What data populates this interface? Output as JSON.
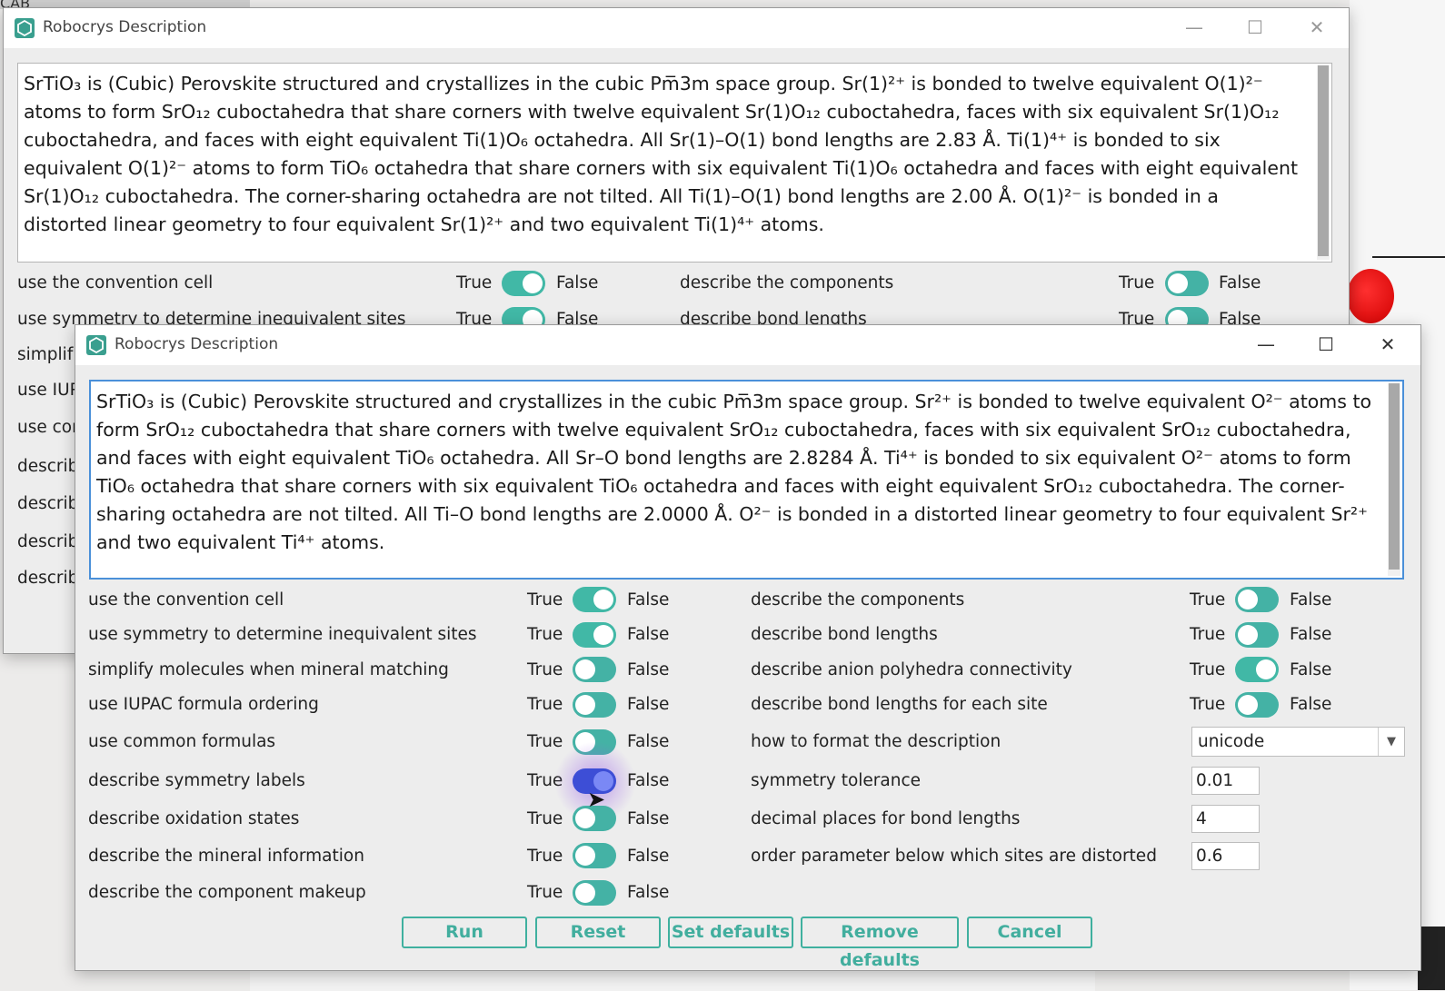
{
  "background": {
    "corner_label": "CAB"
  },
  "win1": {
    "title": "Robocrys Description",
    "description": "SrTiO₃ is (Cubic) Perovskite structured and crystallizes in the cubic Pm̅3m space group. Sr(1)²⁺ is bonded to twelve equivalent O(1)²⁻ atoms to form SrO₁₂ cuboctahedra that share corners with twelve equivalent Sr(1)O₁₂ cuboctahedra, faces with six equivalent Sr(1)O₁₂ cuboctahedra, and faces with eight equivalent Ti(1)O₆ octahedra. All Sr(1)–O(1) bond lengths are 2.83 Å. Ti(1)⁴⁺ is bonded to six equivalent O(1)²⁻ atoms to form TiO₆ octahedra that share corners with six equivalent Ti(1)O₆ octahedra and faces with eight equivalent Sr(1)O₁₂ cuboctahedra. The corner-sharing octahedra are not tilted. All Ti(1)–O(1) bond lengths are 2.00 Å. O(1)²⁻ is bonded in a distorted linear geometry to four equivalent Sr(1)²⁺ and two equivalent Ti(1)⁴⁺ atoms.",
    "left_options": [
      "use the convention cell",
      "use symmetry to determine inequivalent sites",
      "simplif",
      "use IUP",
      "use cor",
      "describ",
      "describ",
      "describ",
      "describ"
    ],
    "right_options": [
      "describe the components",
      "describe bond lengths"
    ]
  },
  "win2": {
    "title": "Robocrys Description",
    "description": "SrTiO₃ is (Cubic) Perovskite structured and crystallizes in the cubic Pm̅3m space group. Sr²⁺ is bonded to twelve equivalent O²⁻ atoms to form SrO₁₂ cuboctahedra that share corners with twelve equivalent SrO₁₂ cuboctahedra, faces with six equivalent SrO₁₂ cuboctahedra, and faces with eight equivalent TiO₆ octahedra. All Sr–O bond lengths are 2.8284 Å. Ti⁴⁺ is bonded to six equivalent O²⁻ atoms to form TiO₆ octahedra that share corners with six equivalent TiO₆ octahedra and faces with eight equivalent SrO₁₂ cuboctahedra. The corner-sharing octahedra are not tilted. All Ti–O bond lengths are 2.0000 Å. O²⁻ is bonded in a distorted linear geometry to four equivalent Sr²⁺ and two equivalent Ti⁴⁺ atoms.",
    "left_options": [
      {
        "label": "use the convention cell",
        "value": "True"
      },
      {
        "label": "use symmetry to determine inequivalent sites",
        "value": "True"
      },
      {
        "label": "simplify molecules when mineral matching",
        "value": "False"
      },
      {
        "label": "use IUPAC formula ordering",
        "value": "False"
      },
      {
        "label": "use common formulas",
        "value": "False"
      },
      {
        "label": "describe symmetry labels",
        "value": "True"
      },
      {
        "label": "describe oxidation states",
        "value": "False"
      },
      {
        "label": "describe the mineral information",
        "value": "False"
      },
      {
        "label": "describe the component makeup",
        "value": "False"
      }
    ],
    "right_toggles": [
      {
        "label": "describe the components",
        "value": "False"
      },
      {
        "label": "describe bond lengths",
        "value": "False"
      },
      {
        "label": "describe anion polyhedra connectivity",
        "value": "True"
      },
      {
        "label": "describe bond lengths for each site",
        "value": "False"
      }
    ],
    "format_label": "how to format the description",
    "format_value": "unicode",
    "tolerance_label": "symmetry tolerance",
    "tolerance_value": "0.01",
    "decimal_label": "decimal places for bond lengths",
    "decimal_value": "4",
    "order_label": "order parameter below which sites are distorted",
    "order_value": "0.6",
    "true_label": "True",
    "false_label": "False",
    "buttons": {
      "run": "Run",
      "reset": "Reset",
      "set_defaults": "Set defaults",
      "remove_defaults": "Remove defaults",
      "cancel": "Cancel"
    }
  },
  "colors": {
    "accent": "#41b8a6",
    "active_toggle": "#3d4ed6"
  }
}
